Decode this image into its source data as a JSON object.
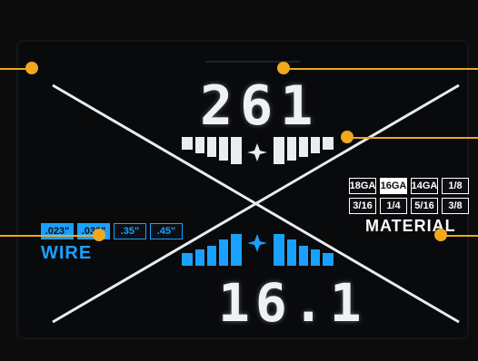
{
  "display": {
    "top_value": "261",
    "bottom_value": "16.1",
    "wire_label": "WIRE",
    "material_label": "MATERIAL"
  },
  "wire_sizes": [
    ".023\"",
    ".030\"",
    ".35\"",
    ".45\""
  ],
  "material_grid": {
    "row1": [
      "18GA",
      "16GA",
      "14GA",
      "1/8"
    ],
    "row2": [
      "3/16",
      "1/4",
      "5/16",
      "3/8"
    ]
  },
  "colors": {
    "accent_blue": "#1aa0ff",
    "annotation_orange": "#f0a81e",
    "display_white": "#eef2f6",
    "background": "#090a0c"
  }
}
